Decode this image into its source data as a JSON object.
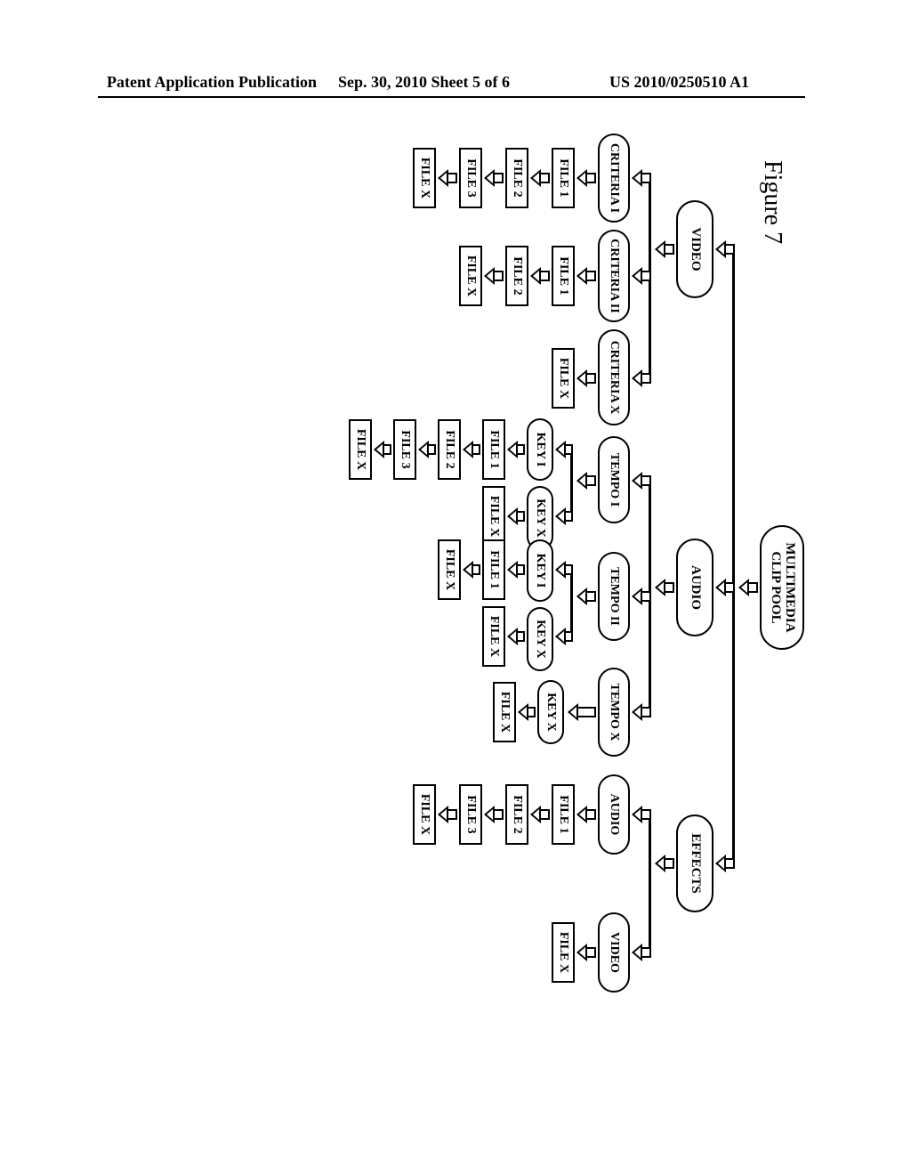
{
  "header": {
    "left": "Patent Application Publication",
    "middle": "Sep. 30, 2010  Sheet 5 of 6",
    "right": "US 2010/0250510 A1"
  },
  "figure_title": "Figure 7",
  "root": {
    "l1": "MULTIMEDIA",
    "l2": "CLIP POOL"
  },
  "lvl1": {
    "video": "VIDEO",
    "audio": "AUDIO",
    "effects": "EFFECTS"
  },
  "video_level": {
    "c1": "CRITERIA I",
    "c2": "CRITERIA II",
    "cx": "CRITERIA X"
  },
  "audio_level": {
    "t1": "TEMPO I",
    "t2": "TEMPO II",
    "tx": "TEMPO X"
  },
  "effects_level": {
    "audio": "AUDIO",
    "video": "VIDEO"
  },
  "keys": {
    "k1": "KEY I",
    "kx": "KEY X"
  },
  "files": {
    "f1": "FILE 1",
    "f2": "FILE 2",
    "f3": "FILE 3",
    "fx": "FILE X"
  }
}
